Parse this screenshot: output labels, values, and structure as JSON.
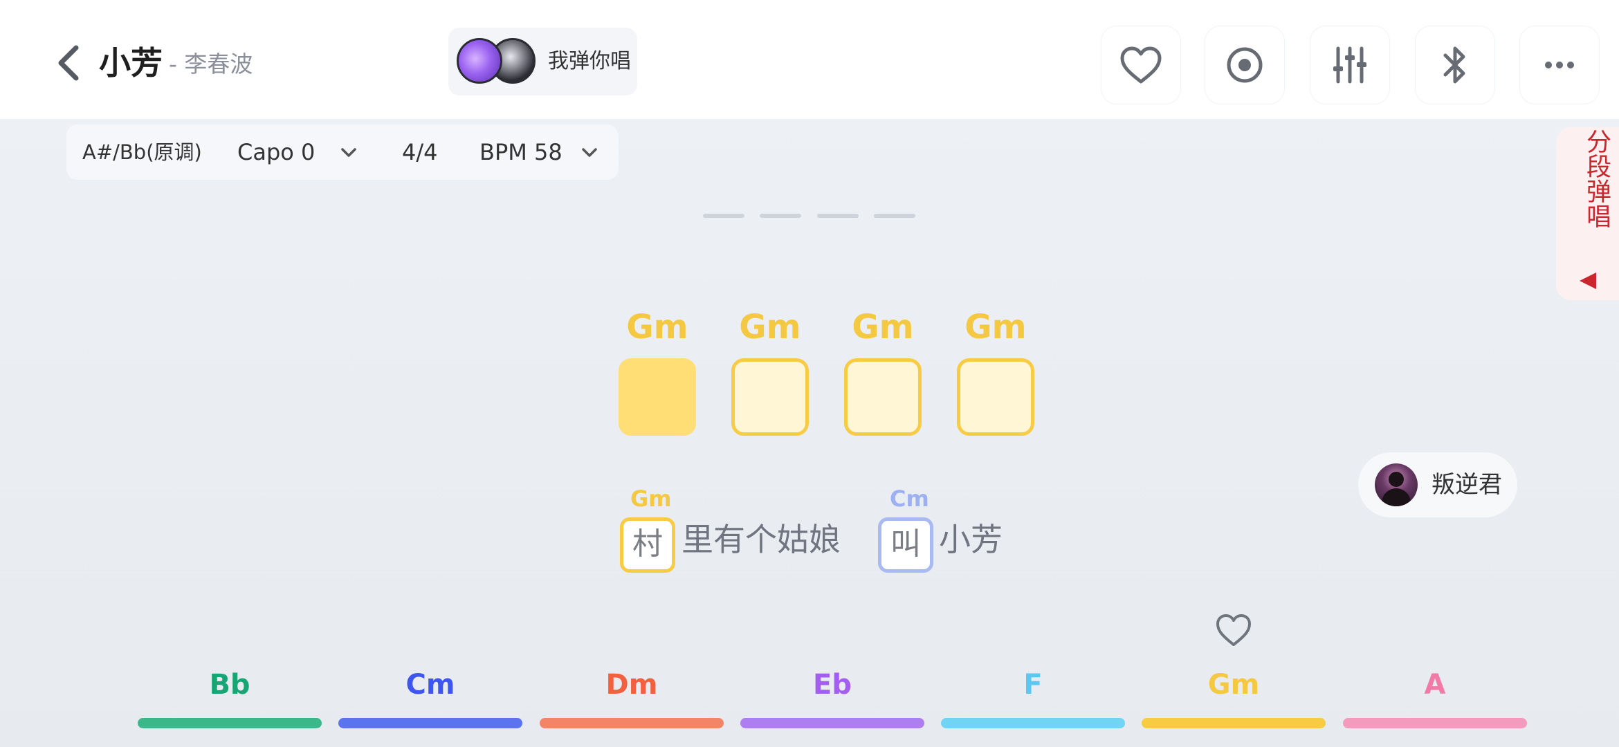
{
  "header": {
    "title": "小芳",
    "artist": "- 李春波",
    "mode_label": "我弹你唱"
  },
  "toolbar_icons": [
    "heart-icon",
    "record-icon",
    "equalizer-icon",
    "bluetooth-icon",
    "more-icon"
  ],
  "settings": {
    "key": "A#/Bb(原调)",
    "capo": "Capo 0",
    "meter": "4/4",
    "bpm": "BPM 58"
  },
  "side_tab": {
    "label": "分段弹唱"
  },
  "progress": {
    "segments": 4
  },
  "beats": [
    {
      "chord": "Gm",
      "active": true
    },
    {
      "chord": "Gm",
      "active": false
    },
    {
      "chord": "Gm",
      "active": false
    },
    {
      "chord": "Gm",
      "active": false
    }
  ],
  "lyrics": [
    {
      "chord": "Gm",
      "chord_color": "#f5c842",
      "char": "村",
      "rest": "里有个姑娘"
    },
    {
      "chord": "Cm",
      "chord_color": "#9db0f2",
      "char": "叫",
      "rest": "小芳"
    }
  ],
  "user": {
    "name": "叛逆君"
  },
  "chord_bar": [
    {
      "name": "Bb",
      "color": "#17a673",
      "bar_color": "#3bb88a"
    },
    {
      "name": "Cm",
      "color": "#3e56f0",
      "bar_color": "#5b73ef"
    },
    {
      "name": "Dm",
      "color": "#f2603f",
      "bar_color": "#f38467"
    },
    {
      "name": "Eb",
      "color": "#a35ef0",
      "bar_color": "#ae7df2"
    },
    {
      "name": "F",
      "color": "#5cc8f2",
      "bar_color": "#72d4f5"
    },
    {
      "name": "Gm",
      "color": "#f5c842",
      "bar_color": "#f7cc42"
    },
    {
      "name": "A",
      "color": "#f27aa6",
      "bar_color": "#f49bbd"
    }
  ]
}
